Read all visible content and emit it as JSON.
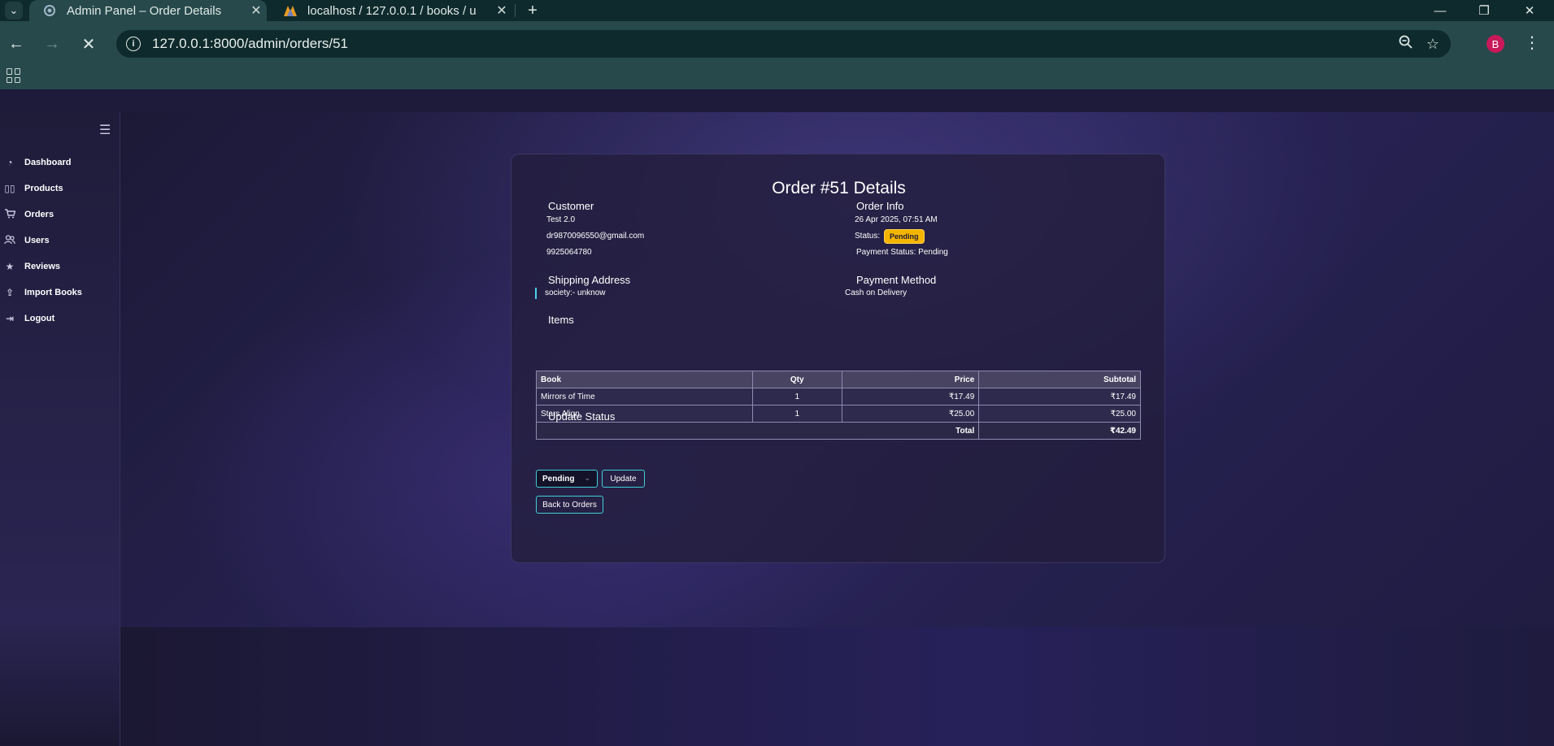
{
  "browser": {
    "tabs": [
      {
        "title": "Admin Panel – Order Details",
        "active": true
      },
      {
        "title": "localhost / 127.0.0.1 / books / u",
        "active": false
      }
    ],
    "url": "127.0.0.1:8000/admin/orders/51",
    "profile_initial": "B"
  },
  "sidebar": {
    "items": [
      {
        "label": "Dashboard",
        "icon": "gauge-icon"
      },
      {
        "label": "Products",
        "icon": "book-icon"
      },
      {
        "label": "Orders",
        "icon": "cart-icon"
      },
      {
        "label": "Users",
        "icon": "users-icon"
      },
      {
        "label": "Reviews",
        "icon": "star-icon"
      },
      {
        "label": "Import Books",
        "icon": "upload-icon"
      },
      {
        "label": "Logout",
        "icon": "logout-icon"
      }
    ]
  },
  "order": {
    "title": "Order #51 Details",
    "customer": {
      "heading": "Customer",
      "name": "Test 2.0",
      "email": "dr9870096550@gmail.com",
      "phone": "9925064780"
    },
    "info": {
      "heading": "Order Info",
      "date": "26 Apr 2025, 07:51 AM",
      "status_label": "Status:",
      "status": "Pending",
      "payment_status": "Payment Status: Pending"
    },
    "shipping": {
      "heading": "Shipping Address",
      "address": "society:- unknow"
    },
    "payment": {
      "heading": "Payment Method",
      "method": "Cash on Delivery"
    },
    "items": {
      "heading": "Items",
      "columns": [
        "Book",
        "Qty",
        "Price",
        "Subtotal"
      ],
      "rows": [
        {
          "book": "Mirrors of Time",
          "qty": "1",
          "price": "₹17.49",
          "subtotal": "₹17.49"
        },
        {
          "book": "Stars Align",
          "qty": "1",
          "price": "₹25.00",
          "subtotal": "₹25.00"
        }
      ],
      "total_label": "Total",
      "total": "₹42.49"
    },
    "update": {
      "heading": "Update Status",
      "selected": "Pending",
      "button": "Update"
    },
    "back_button": "Back to Orders"
  },
  "colors": {
    "accent": "#3fd0d6",
    "badge": "#f5b400"
  }
}
